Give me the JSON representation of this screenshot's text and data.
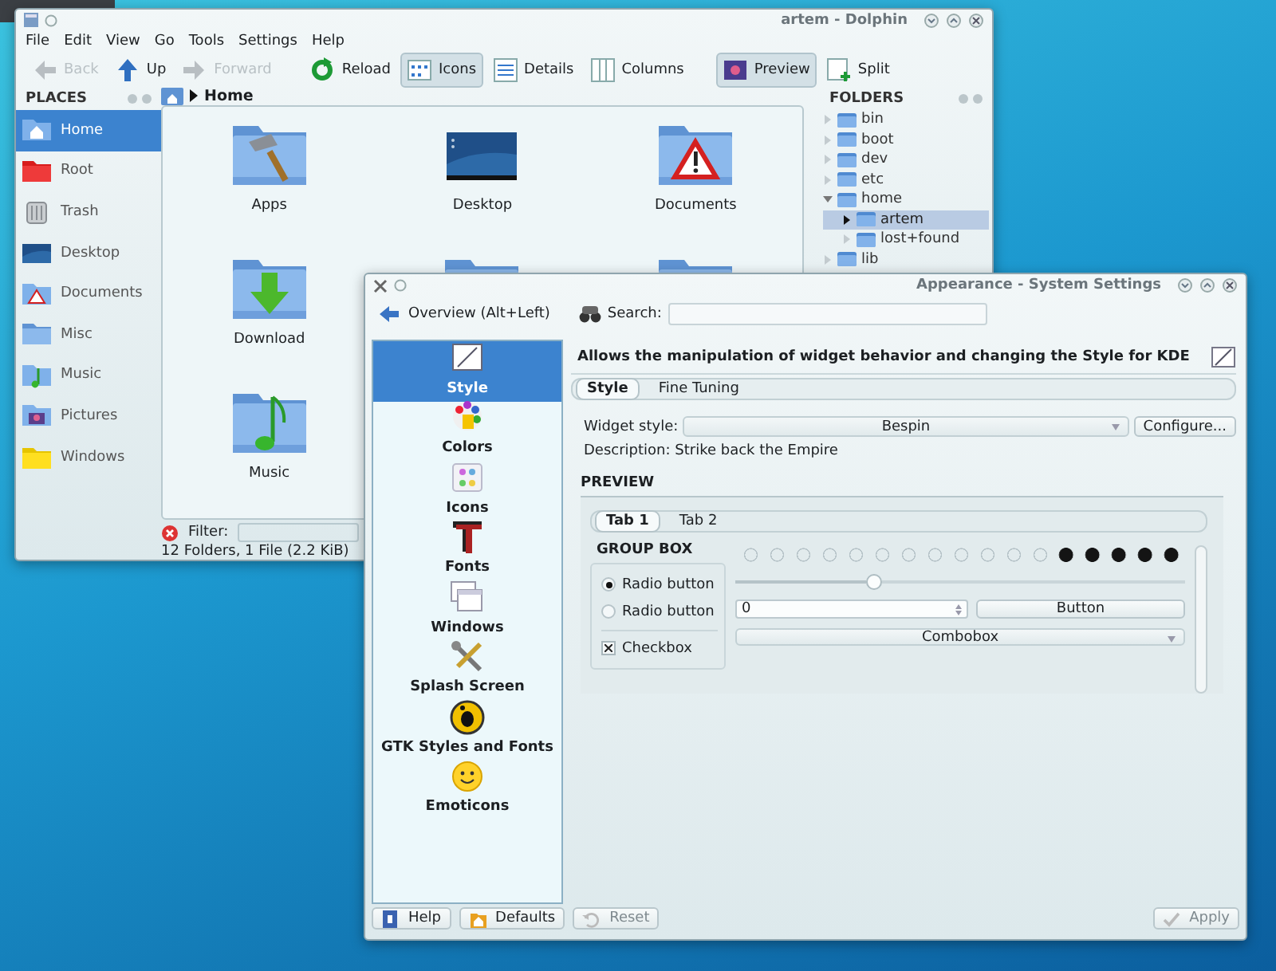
{
  "dolphin": {
    "title": "artem - Dolphin",
    "menu": [
      "File",
      "Edit",
      "View",
      "Go",
      "Tools",
      "Settings",
      "Help"
    ],
    "toolbar": [
      {
        "kind": "back",
        "label": "Back",
        "disabled": true,
        "selected": false
      },
      {
        "kind": "up",
        "label": "Up",
        "disabled": false,
        "selected": false
      },
      {
        "kind": "forward",
        "label": "Forward",
        "disabled": true,
        "selected": false
      },
      {
        "kind": "reload",
        "label": "Reload",
        "disabled": false,
        "selected": false
      },
      {
        "kind": "icons",
        "label": "Icons",
        "disabled": false,
        "selected": true
      },
      {
        "kind": "details",
        "label": "Details",
        "disabled": false,
        "selected": false
      },
      {
        "kind": "columns",
        "label": "Columns",
        "disabled": false,
        "selected": false
      },
      {
        "kind": "preview",
        "label": "Preview",
        "disabled": false,
        "selected": true
      },
      {
        "kind": "split",
        "label": "Split",
        "disabled": false,
        "selected": false
      }
    ],
    "places": {
      "title": "PLACES",
      "items": [
        {
          "kind": "home",
          "label": "Home",
          "selected": true
        },
        {
          "kind": "root",
          "label": "Root",
          "selected": false
        },
        {
          "kind": "trash",
          "label": "Trash",
          "selected": false
        },
        {
          "kind": "desktop",
          "label": "Desktop",
          "selected": false
        },
        {
          "kind": "documents",
          "label": "Documents",
          "selected": false
        },
        {
          "kind": "folder",
          "label": "Misc",
          "selected": false
        },
        {
          "kind": "music",
          "label": "Music",
          "selected": false
        },
        {
          "kind": "pictures",
          "label": "Pictures",
          "selected": false
        },
        {
          "kind": "drive",
          "label": "Windows",
          "selected": false
        }
      ]
    },
    "breadcrumb": "Home",
    "files": [
      {
        "kind": "apps",
        "label": "Apps"
      },
      {
        "kind": "desktop",
        "label": "Desktop"
      },
      {
        "kind": "documents",
        "label": "Documents"
      },
      {
        "kind": "download",
        "label": "Download"
      },
      {
        "kind": "folder"
      },
      {
        "kind": "folder"
      },
      {
        "kind": "music",
        "label": "Music"
      }
    ],
    "filter_label": "Filter:",
    "status": "12 Folders, 1 File (2.2 KiB)",
    "folders": {
      "title": "FOLDERS",
      "tree": [
        {
          "label": "bin",
          "expanded": false,
          "selected": false
        },
        {
          "label": "boot",
          "expanded": false,
          "selected": false
        },
        {
          "label": "dev",
          "expanded": false,
          "selected": false
        },
        {
          "label": "etc",
          "expanded": false,
          "selected": false
        },
        {
          "label": "home",
          "expanded": true,
          "selected": false,
          "children": [
            {
              "label": "artem",
              "expanded": false,
              "selected": true
            },
            {
              "label": "lost+found",
              "expanded": false,
              "selected": false
            }
          ]
        },
        {
          "label": "lib",
          "expanded": false,
          "selected": false
        }
      ]
    }
  },
  "settings": {
    "title": "Appearance - System Settings",
    "overview": "Overview (Alt+Left)",
    "search_label": "Search:",
    "categories": [
      {
        "kind": "style",
        "label": "Style",
        "selected": true
      },
      {
        "kind": "colors",
        "label": "Colors",
        "selected": false
      },
      {
        "kind": "icons",
        "label": "Icons",
        "selected": false
      },
      {
        "kind": "fonts",
        "label": "Fonts",
        "selected": false
      },
      {
        "kind": "windows",
        "label": "Windows",
        "selected": false
      },
      {
        "kind": "splash",
        "label": "Splash Screen",
        "selected": false
      },
      {
        "kind": "gtk",
        "label": "GTK Styles and Fonts",
        "selected": false
      },
      {
        "kind": "emoticons",
        "label": "Emoticons",
        "selected": false
      }
    ],
    "header": "Allows the manipulation of widget behavior and changing the Style for KDE",
    "tabs": [
      {
        "label": "Style",
        "selected": true
      },
      {
        "label": "Fine Tuning",
        "selected": false
      }
    ],
    "widget_style_label": "Widget style:",
    "widget_style": "Bespin",
    "configure": "Configure...",
    "description": "Description: Strike back the Empire",
    "preview": {
      "title": "PREVIEW",
      "tabs": [
        {
          "label": "Tab 1",
          "selected": true
        },
        {
          "label": "Tab 2",
          "selected": false
        }
      ],
      "group_box": "GROUP BOX",
      "radios": [
        {
          "label": "Radio button",
          "selected": true
        },
        {
          "label": "Radio button",
          "selected": false
        }
      ],
      "checkbox": {
        "label": "Checkbox",
        "checked": true
      },
      "progress": {
        "level": 0.3
      },
      "slider": {
        "level": 0.31
      },
      "spin_value": "0",
      "button": "Button",
      "combobox": "Combobox"
    },
    "buttons": [
      {
        "kind": "help",
        "label": "Help",
        "disabled": false
      },
      {
        "kind": "defaults",
        "label": "Defaults",
        "disabled": false
      },
      {
        "kind": "reset",
        "label": "Reset",
        "disabled": true
      },
      {
        "kind": "apply",
        "label": "Apply",
        "disabled": true
      }
    ]
  }
}
